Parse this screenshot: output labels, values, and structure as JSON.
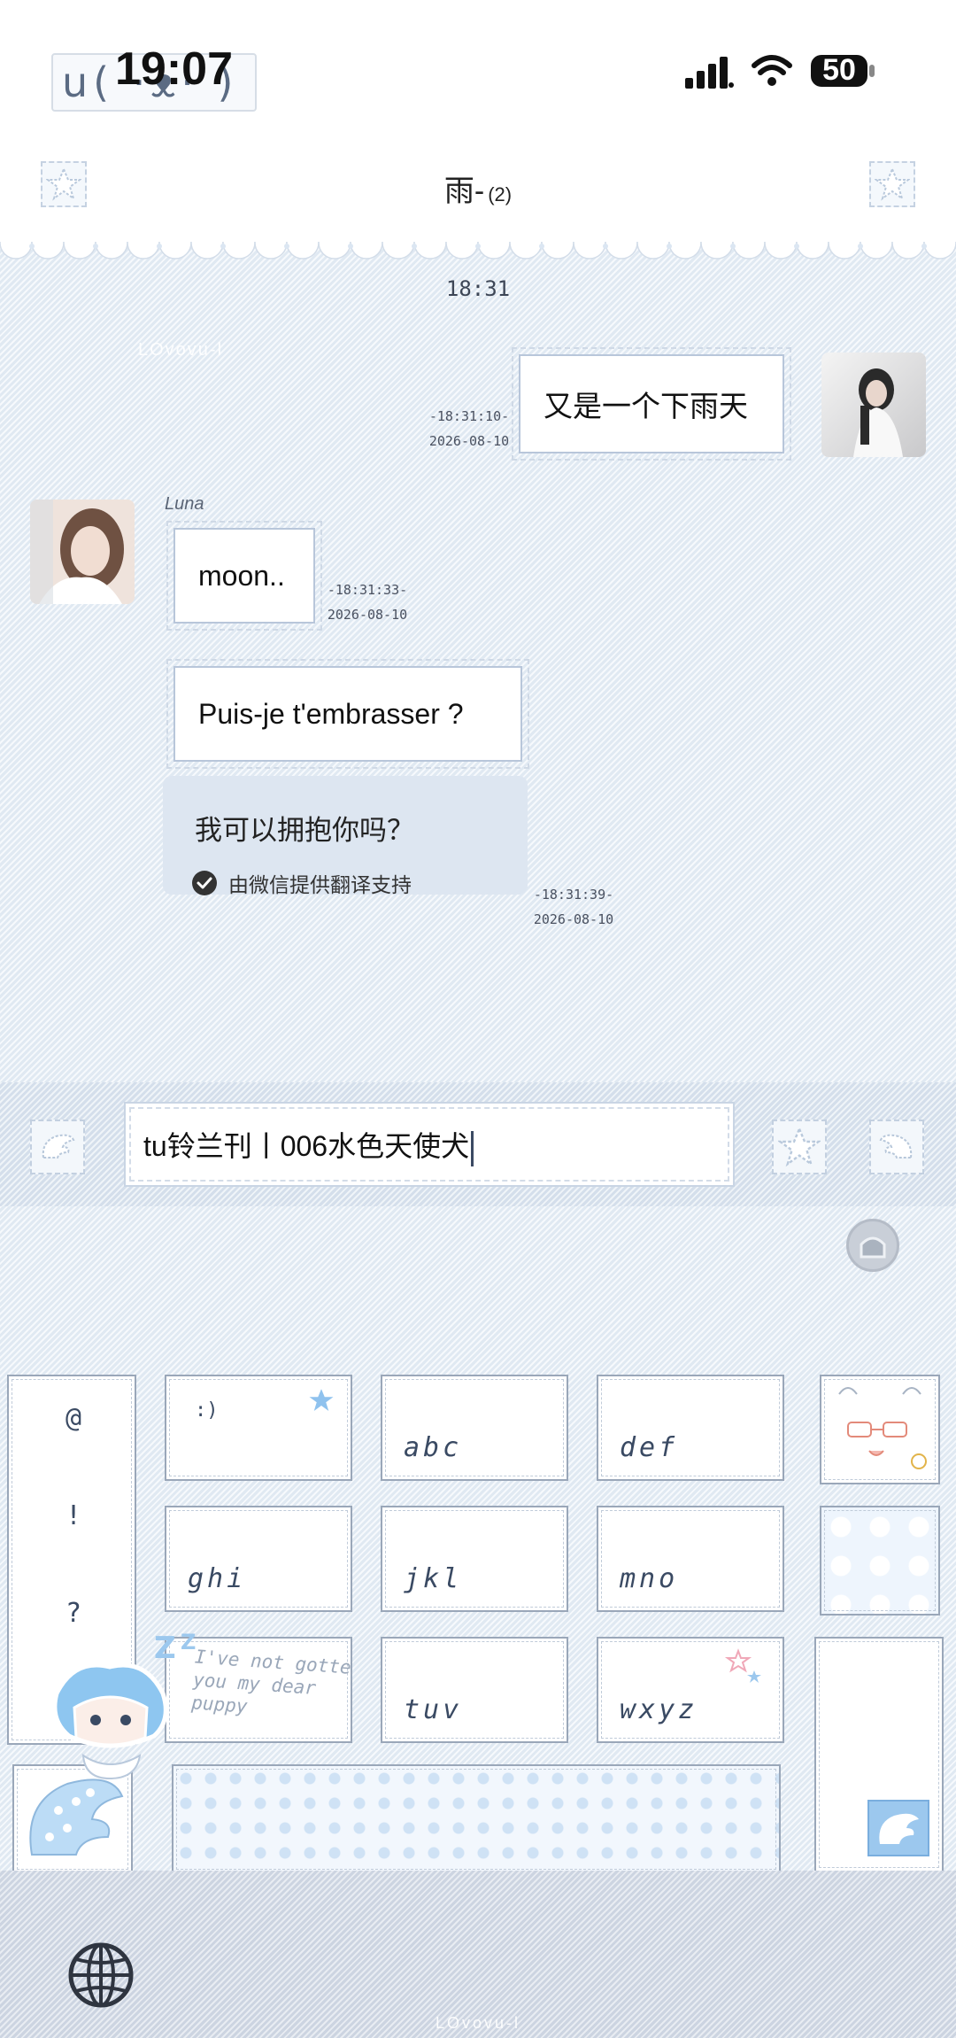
{
  "status_bar": {
    "sticker_text": "u( ·ᴥ· )",
    "time": "19:07",
    "battery": "50"
  },
  "header": {
    "title": "雨-",
    "member_count": "(2)"
  },
  "chat": {
    "timestamp": "18:31",
    "watermark": "LOvovu-l",
    "messages": [
      {
        "side": "right",
        "text": "又是一个下雨天",
        "time": "-18:31:10-",
        "date": "2026-08-10"
      },
      {
        "side": "left",
        "sender": "Luna",
        "text": "moon..",
        "time": "-18:31:33-",
        "date": "2026-08-10"
      },
      {
        "side": "left",
        "text": "Puis-je t'embrasser ?",
        "time": "-18:31:39-",
        "date": "2026-08-10",
        "translation": "我可以拥抱你吗？",
        "translation_credit": "由微信提供翻译支持"
      }
    ]
  },
  "input": {
    "value": "tu铃兰刊丨006水色天使犬"
  },
  "keyboard": {
    "symbols": [
      "@",
      "!",
      "?"
    ],
    "keys": [
      ":)",
      "abc",
      "def",
      "ghi",
      "jkl",
      "mno",
      "tuv",
      "wxyz"
    ],
    "sticker_text": "I've not gotten you my dear puppy",
    "bottom_text": "",
    "watermark": "LOvovu-l"
  },
  "colors": {
    "bubble_border": "#b8c6da",
    "translation_bg": "#dde6f1",
    "accent_blue": "#9cc8ee"
  },
  "icons": {
    "back": "star-icon",
    "more": "star-icon",
    "voice": "wing-icon",
    "emoji": "star-icon",
    "plus": "wing-icon",
    "keyboard_toggle": "house-icon",
    "globe": "globe-icon"
  }
}
